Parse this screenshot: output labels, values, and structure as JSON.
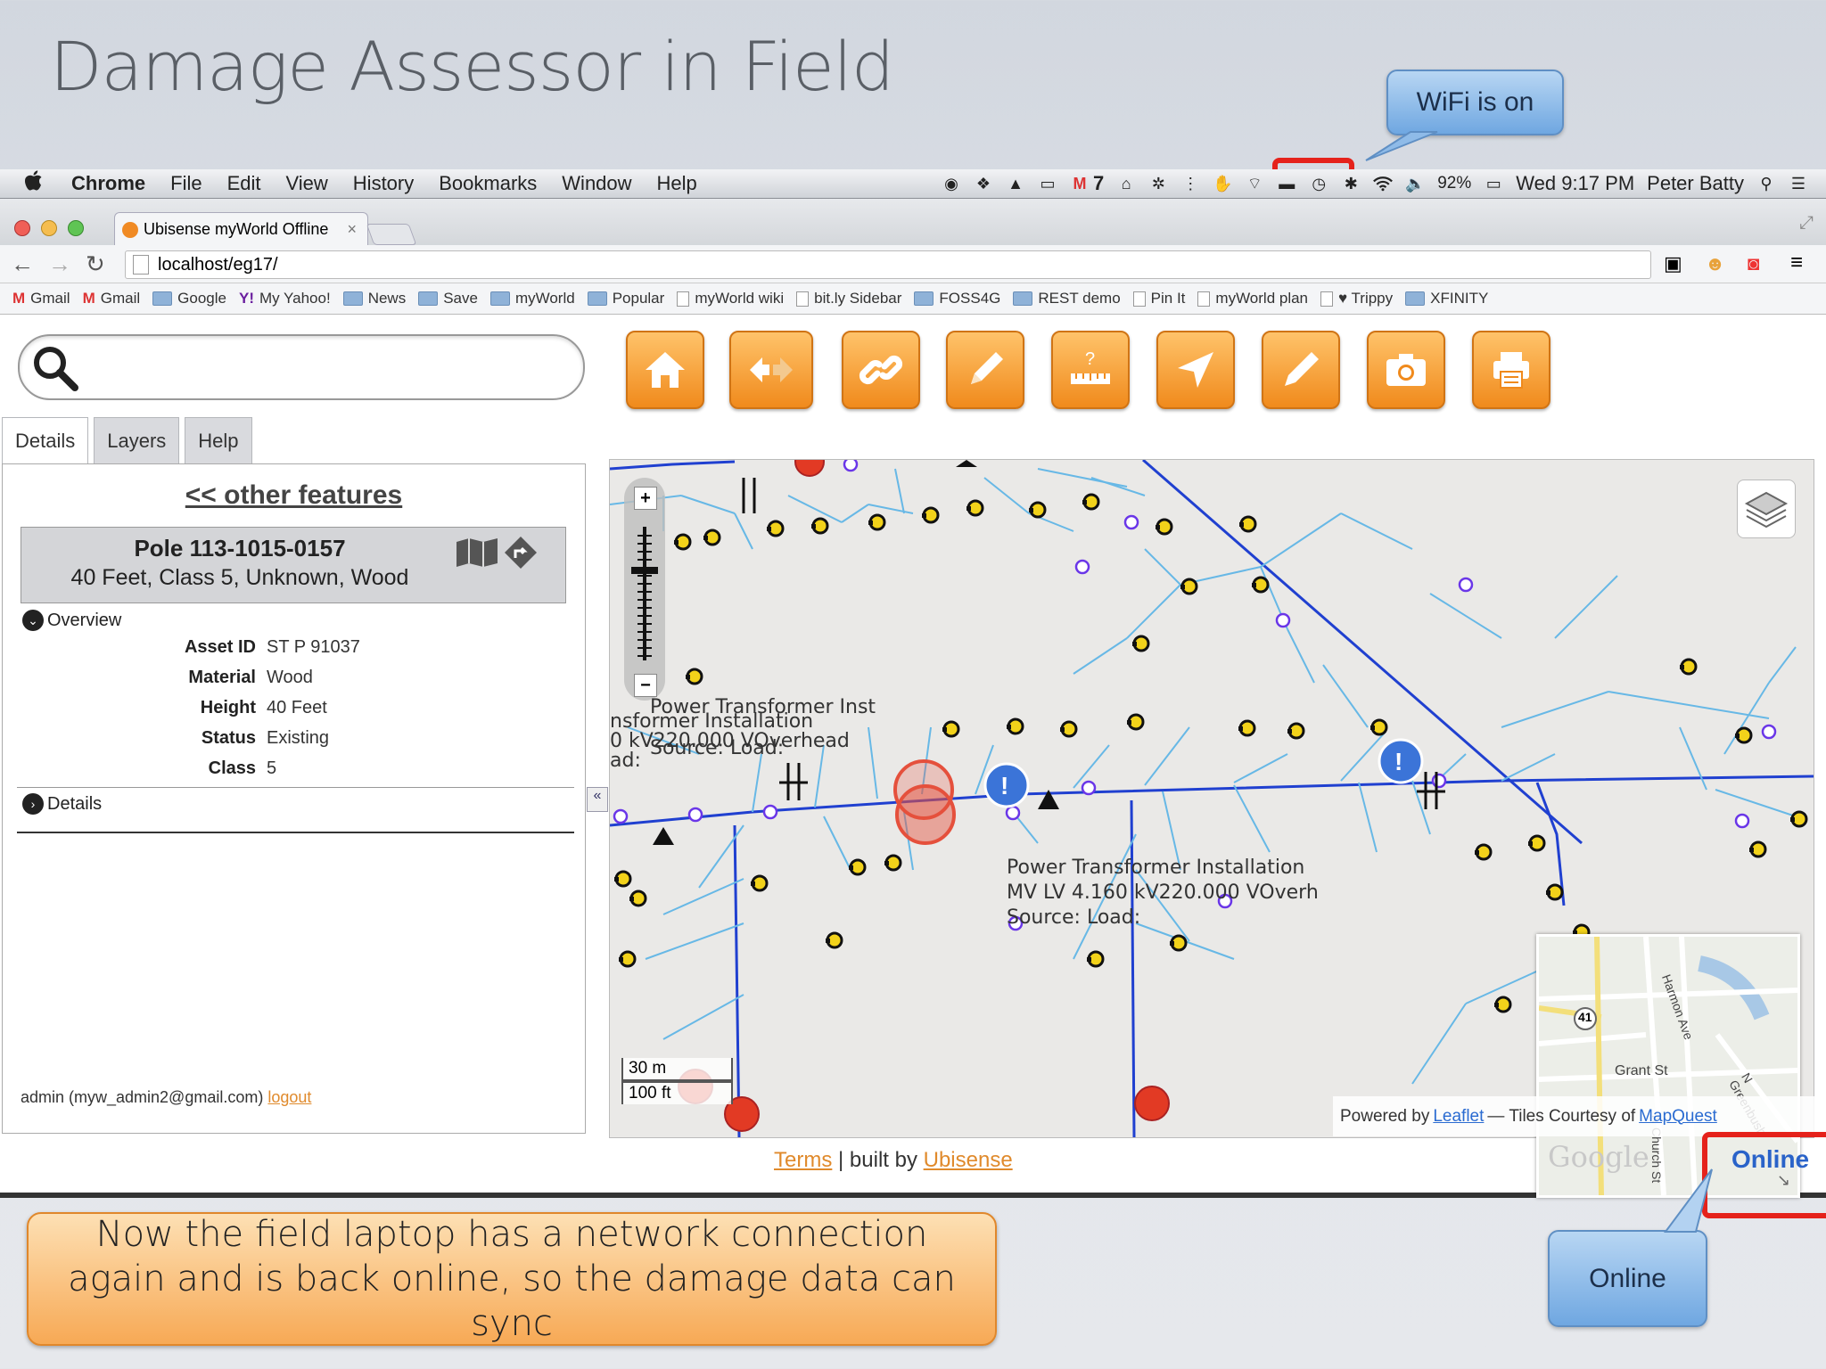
{
  "slide": {
    "title": "Damage Assessor in Field",
    "wifi_callout": "WiFi is on",
    "online_callout": "Online",
    "note": "Now the field laptop has a network connection again and is back online, so the damage data can sync"
  },
  "menubar": {
    "items": [
      "Chrome",
      "File",
      "Edit",
      "View",
      "History",
      "Bookmarks",
      "Window",
      "Help"
    ],
    "mail_count": "7",
    "battery": "92%",
    "clock": "Wed 9:17 PM",
    "user": "Peter Batty"
  },
  "browser": {
    "tab_title": "Ubisense myWorld Offline",
    "tab_close": "×",
    "url": "localhost/eg17/",
    "bookmarks": [
      {
        "label": "Gmail",
        "icon": "gmail-icon"
      },
      {
        "label": "Gmail",
        "icon": "gmail-icon"
      },
      {
        "label": "Google",
        "icon": "folder-icon"
      },
      {
        "label": "My Yahoo!",
        "icon": "yahoo-icon"
      },
      {
        "label": "News",
        "icon": "folder-icon"
      },
      {
        "label": "Save",
        "icon": "folder-icon"
      },
      {
        "label": "myWorld",
        "icon": "folder-icon"
      },
      {
        "label": "Popular",
        "icon": "folder-icon"
      },
      {
        "label": "myWorld wiki",
        "icon": "page-icon"
      },
      {
        "label": "bit.ly Sidebar",
        "icon": "page-icon"
      },
      {
        "label": "FOSS4G",
        "icon": "folder-icon"
      },
      {
        "label": "REST demo",
        "icon": "folder-icon"
      },
      {
        "label": "Pin It",
        "icon": "page-icon"
      },
      {
        "label": "myWorld plan",
        "icon": "page-icon"
      },
      {
        "label": "♥ Trippy",
        "icon": "page-icon"
      },
      {
        "label": "XFINITY",
        "icon": "folder-icon"
      }
    ]
  },
  "app": {
    "tabs": [
      "Details",
      "Layers",
      "Help"
    ],
    "other_features": "<< other features",
    "feature_title": "Pole 113-1015-0157",
    "feature_subtitle": "40 Feet, Class 5, Unknown, Wood",
    "overview_label": "Overview",
    "attributes": [
      {
        "key": "Asset ID",
        "value": "ST P 91037"
      },
      {
        "key": "Material",
        "value": "Wood"
      },
      {
        "key": "Height",
        "value": "40 Feet"
      },
      {
        "key": "Status",
        "value": "Existing"
      },
      {
        "key": "Class",
        "value": "5"
      }
    ],
    "details_label": "Details",
    "admin_text": "admin (myw_admin2@gmail.com)",
    "logout": "logout",
    "collapse": "«",
    "footer_terms": "Terms",
    "footer_built_by": " | built by ",
    "footer_company": "Ubisense",
    "status": "Online",
    "toolbar": [
      "home-icon",
      "back-forward-icon",
      "link-icon",
      "edit-icon",
      "measure-icon",
      "navigate-icon",
      "pencil-icon",
      "camera-icon",
      "print-icon"
    ]
  },
  "map": {
    "zoom_in": "+",
    "zoom_out": "−",
    "scale_metric": "30 m",
    "scale_imperial": "100 ft",
    "attribution_prefix": "Powered by",
    "attribution_leaflet": "Leaflet",
    "attribution_tiles": "— Tiles Courtesy of",
    "attribution_mapquest": "MapQuest",
    "labels": {
      "a1": "Power Transformer Inst",
      "a2": "nsformer Installation",
      "a3": "0 kV220.000 VOverhead",
      "a4": "ad:",
      "a5": "Source: Load:",
      "b1": "Power Transformer Installation",
      "b2": "MV LV 4.160 kV220.000 VOverh",
      "b3": "Source: Load:"
    },
    "minimap_labels": {
      "street1": "Grant St",
      "street2": "N Church St",
      "street3": "Harmon Ave",
      "street4": "N Greenbush",
      "route": "41",
      "brand": "Google"
    },
    "colors": {
      "line_light": "#67b8e6",
      "line_dark": "#2040d0",
      "accent": "#f29a2e",
      "online": "#2a63c9",
      "highlight": "#e5221b"
    }
  }
}
